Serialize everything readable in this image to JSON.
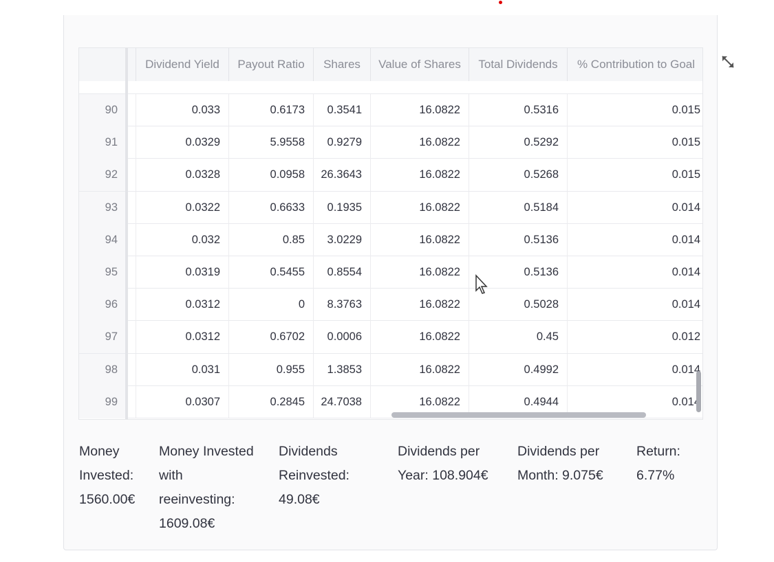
{
  "table": {
    "columns": [
      "",
      "Dividend Yield",
      "Payout Ratio",
      "Shares",
      "Value of Shares",
      "Total Dividends",
      "% Contribution to Goal"
    ],
    "rows": [
      {
        "index": "90",
        "cells": [
          "0.033",
          "0.6173",
          "0.3541",
          "16.0822",
          "0.5316",
          "0.015"
        ]
      },
      {
        "index": "91",
        "cells": [
          "0.0329",
          "5.9558",
          "0.9279",
          "16.0822",
          "0.5292",
          "0.015"
        ]
      },
      {
        "index": "92",
        "cells": [
          "0.0328",
          "0.0958",
          "26.3643",
          "16.0822",
          "0.5268",
          "0.015"
        ]
      },
      {
        "index": "93",
        "cells": [
          "0.0322",
          "0.6633",
          "0.1935",
          "16.0822",
          "0.5184",
          "0.014"
        ]
      },
      {
        "index": "94",
        "cells": [
          "0.032",
          "0.85",
          "3.0229",
          "16.0822",
          "0.5136",
          "0.014"
        ]
      },
      {
        "index": "95",
        "cells": [
          "0.0319",
          "0.5455",
          "0.8554",
          "16.0822",
          "0.5136",
          "0.014"
        ]
      },
      {
        "index": "96",
        "cells": [
          "0.0312",
          "0",
          "8.3763",
          "16.0822",
          "0.5028",
          "0.014"
        ]
      },
      {
        "index": "97",
        "cells": [
          "0.0312",
          "0.6702",
          "0.0006",
          "16.0822",
          "0.45",
          "0.012"
        ]
      },
      {
        "index": "98",
        "cells": [
          "0.031",
          "0.955",
          "1.3853",
          "16.0822",
          "0.4992",
          "0.014"
        ]
      },
      {
        "index": "99",
        "cells": [
          "0.0307",
          "0.2845",
          "24.7038",
          "16.0822",
          "0.4944",
          "0.014"
        ]
      }
    ]
  },
  "summary": {
    "money_invested": [
      "Money",
      "Invested:",
      "1560.00€"
    ],
    "money_reinvesting": [
      "Money Invested",
      "with",
      "reeinvesting:",
      "1609.08€"
    ],
    "dividends_reinvested": [
      "Dividends",
      "Reinvested:",
      "49.08€"
    ],
    "dividends_year": [
      "Dividends per",
      "Year: 108.904€"
    ],
    "dividends_month": [
      "Dividends per",
      "Month: 9.075€"
    ],
    "return": [
      "Return:",
      "6.77%"
    ]
  },
  "icons": {
    "expand": "expand-icon",
    "cursor": "mouse-pointer-icon"
  },
  "colors": {
    "indicator": "#e00000",
    "scrollbar": "#b9bbc2"
  }
}
